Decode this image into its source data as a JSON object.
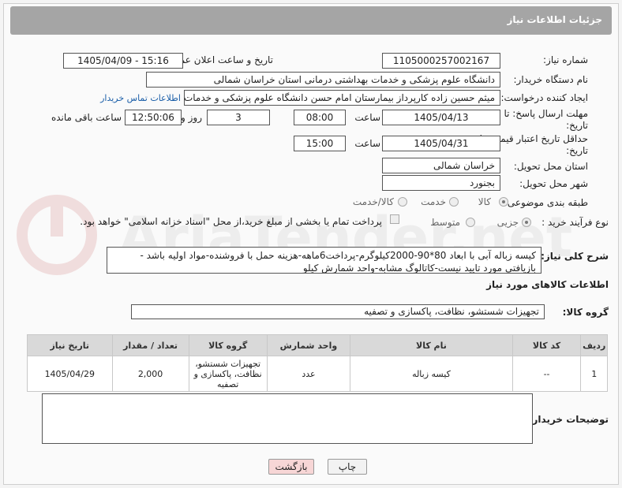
{
  "header": {
    "title": "جزئیات اطلاعات نیاز"
  },
  "form": {
    "need_number_label": "شماره نیاز:",
    "need_number": "1105000257002167",
    "announce_label": "تاریخ و ساعت اعلان عمومی:",
    "announce_value": "1405/04/09 - 15:16",
    "buyer_org_label": "نام دستگاه خریدار:",
    "buyer_org": "دانشگاه علوم پزشکی و خدمات بهداشتی درمانی استان خراسان شمالی",
    "creator_label": "ایجاد کننده درخواست:",
    "creator": "میثم  حسین زاده  کارپرداز بیمارستان امام حسن دانشگاه علوم پزشکی و خدمات",
    "contact_link": "اطلاعات تماس خریدار",
    "reply_deadline_label": "مهلت ارسال پاسخ: تا تاریخ:",
    "reply_date": "1405/04/13",
    "time_label": "ساعت",
    "reply_time": "08:00",
    "days_value": "3",
    "days_label": "روز و",
    "remaining_time": "12:50:06",
    "remaining_label": "ساعت باقی مانده",
    "price_validity_label": "حداقل تاریخ اعتبار قیمت: تا تاریخ:",
    "price_date": "1405/04/31",
    "time_label2": "ساعت",
    "price_time": "15:00",
    "delivery_province_label": "استان محل تحویل:",
    "delivery_province": "خراسان شمالی",
    "delivery_city_label": "شهر محل تحویل:",
    "delivery_city": "بجنورد",
    "category_label": "طبقه بندی موضوعی:",
    "category_options": [
      "کالا",
      "خدمت",
      "کالا/خدمت"
    ],
    "process_label": "نوع فرآیند خرید :",
    "process_options": [
      "جزیی",
      "متوسط"
    ],
    "payment_note": "پرداخت تمام یا بخشی از مبلغ خرید،از محل \"اسناد خزانه اسلامی\" خواهد بود.",
    "description_label": "شرح کلی نیاز:",
    "description": "کیسه زباله آبی با ابعاد 80*90-2000کیلوگرم-پرداخت6ماهه-هزینه حمل با فروشنده-مواد اولیه باشد - بازیافتی مورد تایید نیست-کاتالوگ مشابه-واحد شمارش کیلو"
  },
  "goods": {
    "section_title": "اطلاعات کالاهای مورد نیاز",
    "group_label": "گروه کالا:",
    "group_value": "تجهیزات شستشو، نظافت، پاکسازی و تصفیه",
    "columns": [
      "ردیف",
      "کد کالا",
      "نام کالا",
      "واحد شمارش",
      "گروه کالا",
      "تعداد / مقدار",
      "تاریخ نیاز"
    ],
    "rows": [
      [
        "1",
        "--",
        "کیسه زباله",
        "عدد",
        "تجهیزات شستشو، نظافت، پاکسازی و تصفیه",
        "2,000",
        "1405/04/29"
      ]
    ]
  },
  "buyer_notes_label": "توضیحات خریدار:",
  "buyer_notes": "",
  "buttons": {
    "print": "چاپ",
    "back": "بازگشت"
  },
  "watermark": "AriaTender.net"
}
